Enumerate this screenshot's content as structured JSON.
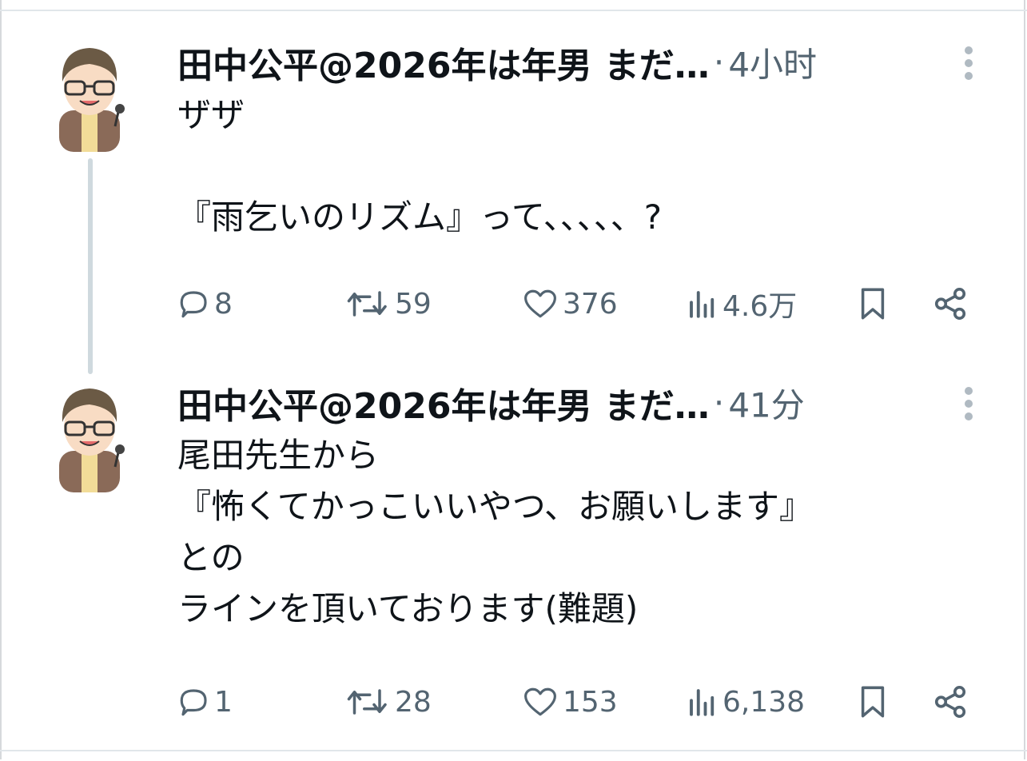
{
  "tweets": [
    {
      "author": "田中公平@2026年は年男 まだ…",
      "separator": "·",
      "time": "4小时",
      "text": "ザザ\n\n『雨乞いのリズム』って、、、、、?",
      "actions": {
        "replies": "8",
        "retweets": "59",
        "likes": "376",
        "views": "4.6万"
      }
    },
    {
      "author": "田中公平@2026年は年男 まだ…",
      "separator": "·",
      "time": "41分",
      "text": "尾田先生から\n『怖くてかっこいいやつ、お願いします』\nとの\nラインを頂いております(難題)",
      "actions": {
        "replies": "1",
        "retweets": "28",
        "likes": "153",
        "views": "6,138"
      }
    }
  ],
  "icons": {
    "reply": "speech-bubble-icon",
    "retweet": "retweet-icon",
    "like": "heart-icon",
    "views": "bar-chart-icon",
    "bookmark": "bookmark-icon",
    "share": "share-icon",
    "more": "vertical-ellipsis-icon"
  },
  "colors": {
    "text": "#0f1419",
    "muted": "#536471",
    "thread_line": "#cfd9de"
  }
}
